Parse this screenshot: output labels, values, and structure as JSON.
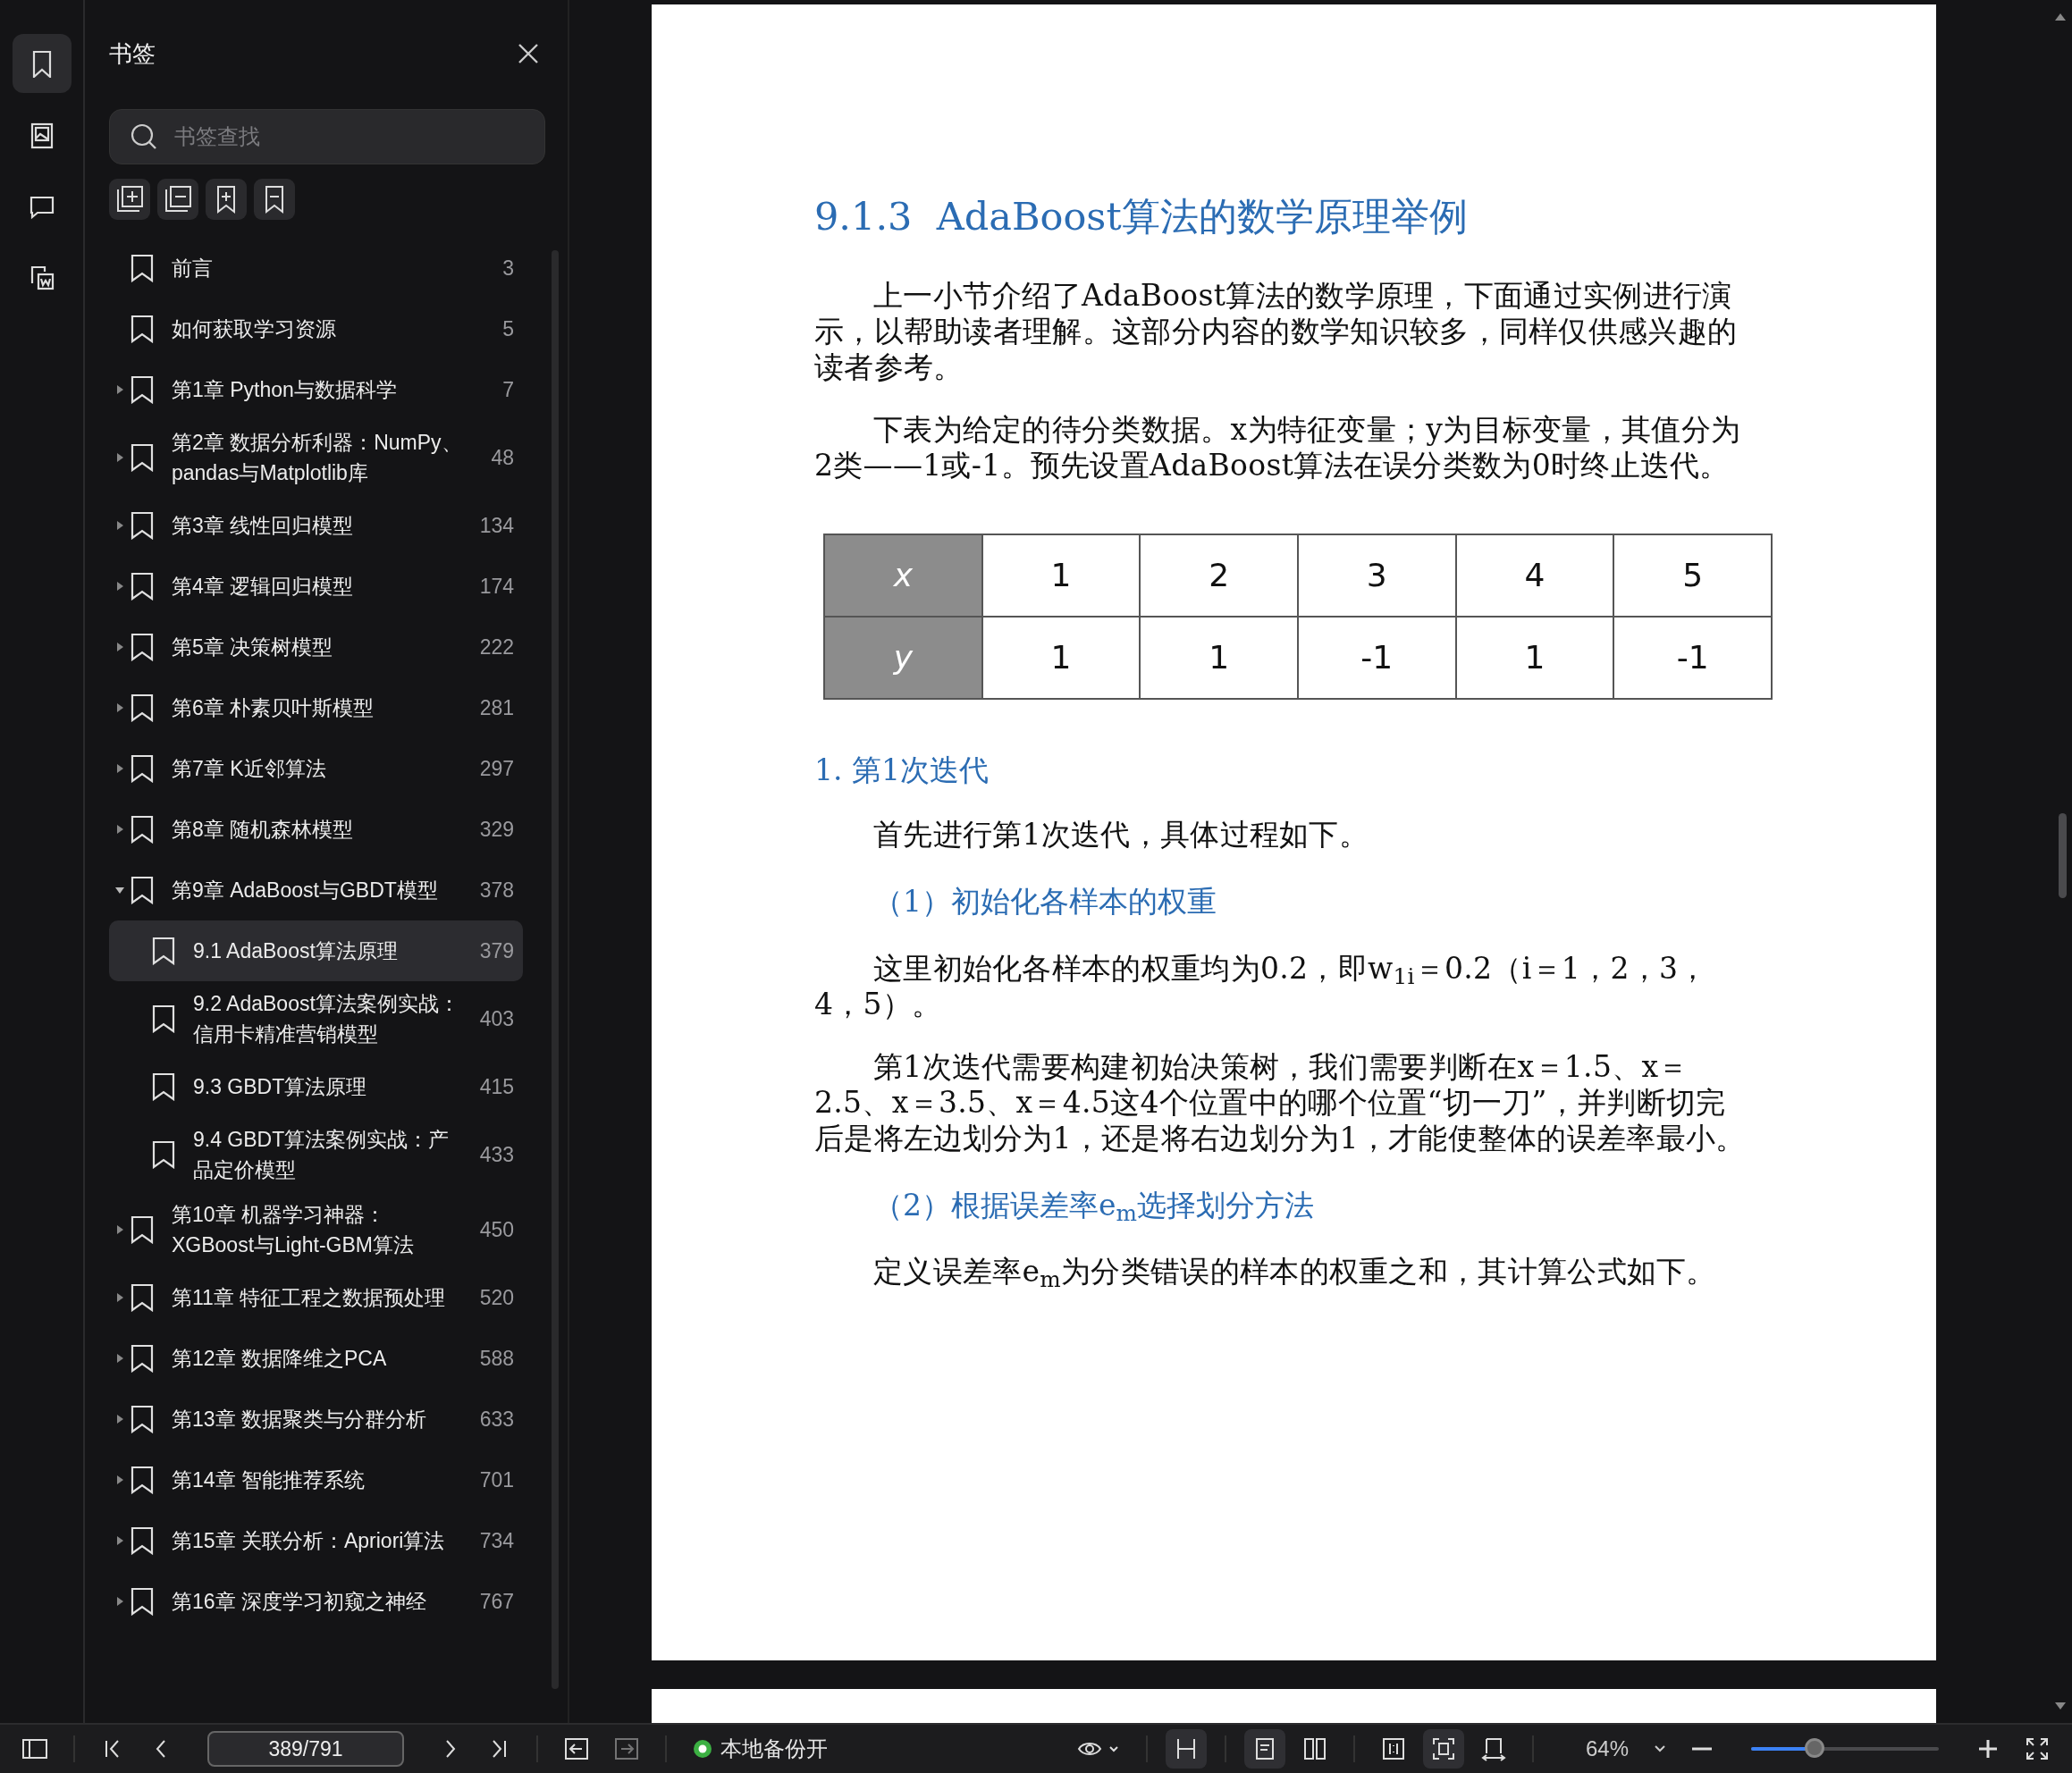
{
  "rail": [
    {
      "kind": "bookmarks",
      "selected": true
    },
    {
      "kind": "thumbnails",
      "selected": false
    },
    {
      "kind": "comments",
      "selected": false
    },
    {
      "kind": "convert",
      "selected": false
    }
  ],
  "sidebar": {
    "title": "书签",
    "search": {
      "placeholder": "书签查找"
    },
    "bookmarks": [
      {
        "title": "前言",
        "page": "3",
        "selected": false
      },
      {
        "title": "如何获取学习资源",
        "page": "5",
        "selected": false
      },
      {
        "title": "第1章 Python与数据科学",
        "page": "7",
        "expanded": false,
        "selected": false
      },
      {
        "title": "第2章 数据分析利器：NumPy、pandas与Matplotlib库",
        "page": "48",
        "expanded": false,
        "selected": false
      },
      {
        "title": "第3章 线性回归模型",
        "page": "134",
        "expanded": false,
        "selected": false
      },
      {
        "title": "第4章 逻辑回归模型",
        "page": "174",
        "expanded": false,
        "selected": false
      },
      {
        "title": "第5章 决策树模型",
        "page": "222",
        "expanded": false,
        "selected": false
      },
      {
        "title": "第6章 朴素贝叶斯模型",
        "page": "281",
        "expanded": false,
        "selected": false
      },
      {
        "title": "第7章 K近邻算法",
        "page": "297",
        "expanded": false,
        "selected": false
      },
      {
        "title": "第8章 随机森林模型",
        "page": "329",
        "expanded": false,
        "selected": false
      },
      {
        "title": "第9章 AdaBoost与GBDT模型",
        "page": "378",
        "expanded": true,
        "selected": false,
        "children": [
          {
            "title": "9.1 AdaBoost算法原理",
            "page": "379",
            "selected": true
          },
          {
            "title": "9.2 AdaBoost算法案例实战：信用卡精准营销模型",
            "page": "403",
            "selected": false
          },
          {
            "title": "9.3 GBDT算法原理",
            "page": "415",
            "selected": false
          },
          {
            "title": "9.4 GBDT算法案例实战：产品定价模型",
            "page": "433",
            "selected": false
          }
        ]
      },
      {
        "title": "第10章 机器学习神器：XGBoost与Light-GBM算法",
        "page": "450",
        "expanded": false,
        "selected": false
      },
      {
        "title": "第11章 特征工程之数据预处理",
        "page": "520",
        "expanded": false,
        "selected": false
      },
      {
        "title": "第12章 数据降维之PCA",
        "page": "588",
        "expanded": false,
        "selected": false
      },
      {
        "title": "第13章 数据聚类与分群分析",
        "page": "633",
        "expanded": false,
        "selected": false
      },
      {
        "title": "第14章 智能推荐系统",
        "page": "701",
        "expanded": false,
        "selected": false
      },
      {
        "title": "第15章 关联分析：Apriori算法",
        "page": "734",
        "expanded": false,
        "selected": false
      },
      {
        "title": "第16章 深度学习初窥之神经",
        "page": "767",
        "expanded": false,
        "selected": false
      }
    ]
  },
  "page_blocks": [
    {
      "kind": "heading",
      "text": "9.1.3  AdaBoost算法的数学原理举例"
    },
    {
      "kind": "paragraph",
      "text": "上一小节介绍了AdaBoost算法的数学原理，下面通过实例进行演示，以帮助读者理解。这部分内容的数学知识较多，同样仅供感兴趣的读者参考。"
    },
    {
      "kind": "paragraph",
      "text": "下表为给定的待分类数据。x为特征变量；y为目标变量，其值分为2类——1或-1。预先设置AdaBoost算法在误分类数为0时终止迭代。"
    },
    {
      "kind": "table",
      "rows": [
        [
          "x",
          "1",
          "2",
          "3",
          "4",
          "5"
        ],
        [
          "y",
          "1",
          "1",
          "-1",
          "1",
          "-1"
        ]
      ]
    },
    {
      "kind": "subheading",
      "text": "1. 第1次迭代"
    },
    {
      "kind": "paragraph",
      "text": "首先进行第1次迭代，具体过程如下。"
    },
    {
      "kind": "subsubheading",
      "text": "（1）初始化各样本的权重"
    },
    {
      "kind": "paragraph",
      "text": "这里初始化各样本的权重均为0.2，即w$_{1i}$＝0.2（i＝1，2，3，4，5）。"
    },
    {
      "kind": "paragraph",
      "text": "第1次迭代需要构建初始决策树，我们需要判断在x＝1.5、x＝2.5、x＝3.5、x＝4.5这4个位置中的哪个位置“切一刀”，并判断切完后是将左边划分为1，还是将右边划分为1，才能使整体的误差率最小。"
    },
    {
      "kind": "subsubheading",
      "text": "（2）根据误差率e$_{m}$选择划分方法"
    },
    {
      "kind": "paragraph",
      "text": "定义误差率e$_{m}$为分类错误的样本的权重之和，其计算公式如下。"
    }
  ],
  "toolbar": {
    "page_field": "389/791",
    "back_disabled": false,
    "forward_disabled": true,
    "backup": {
      "on": true,
      "label": "本地备份开"
    },
    "view_modes": [
      {
        "kind": "continuous",
        "selected": true
      },
      {
        "kind": "single",
        "selected": true
      },
      {
        "kind": "double",
        "selected": false
      },
      {
        "kind": "actual",
        "selected": false
      },
      {
        "kind": "fit",
        "selected": true
      },
      {
        "kind": "width",
        "selected": false
      }
    ],
    "zoom": "64%",
    "zoom_slider": {
      "level": 0.34
    }
  }
}
